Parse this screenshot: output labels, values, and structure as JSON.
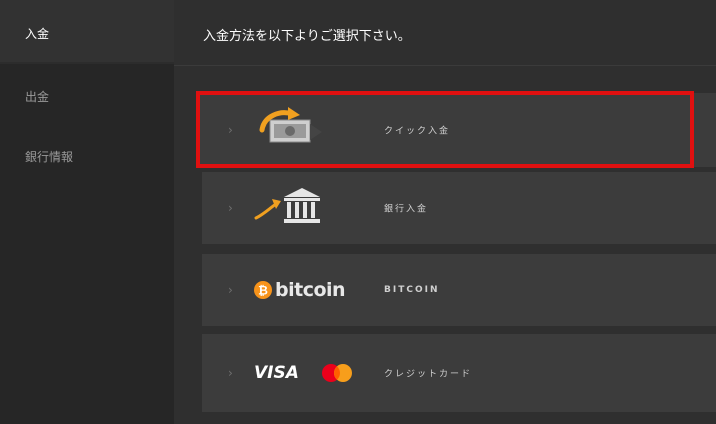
{
  "sidebar": {
    "items": [
      {
        "label": "入金"
      },
      {
        "label": "出金"
      },
      {
        "label": "銀行情報"
      }
    ]
  },
  "main": {
    "title": "入金方法を以下よりご選択下さい。",
    "methods": [
      {
        "label": "クイック入金",
        "icon": "quick-deposit-icon"
      },
      {
        "label": "銀行入金",
        "icon": "bank-icon"
      },
      {
        "label": "BITCOIN",
        "icon": "bitcoin-logo",
        "logo_text": "bitcoin"
      },
      {
        "label": "クレジットカード",
        "icon": "visa-mastercard-logo",
        "logo_text": "VISA"
      }
    ]
  },
  "colors": {
    "highlight": "#e01010",
    "bitcoin_orange": "#f7931a",
    "arrow_gold": "#f0a020"
  }
}
